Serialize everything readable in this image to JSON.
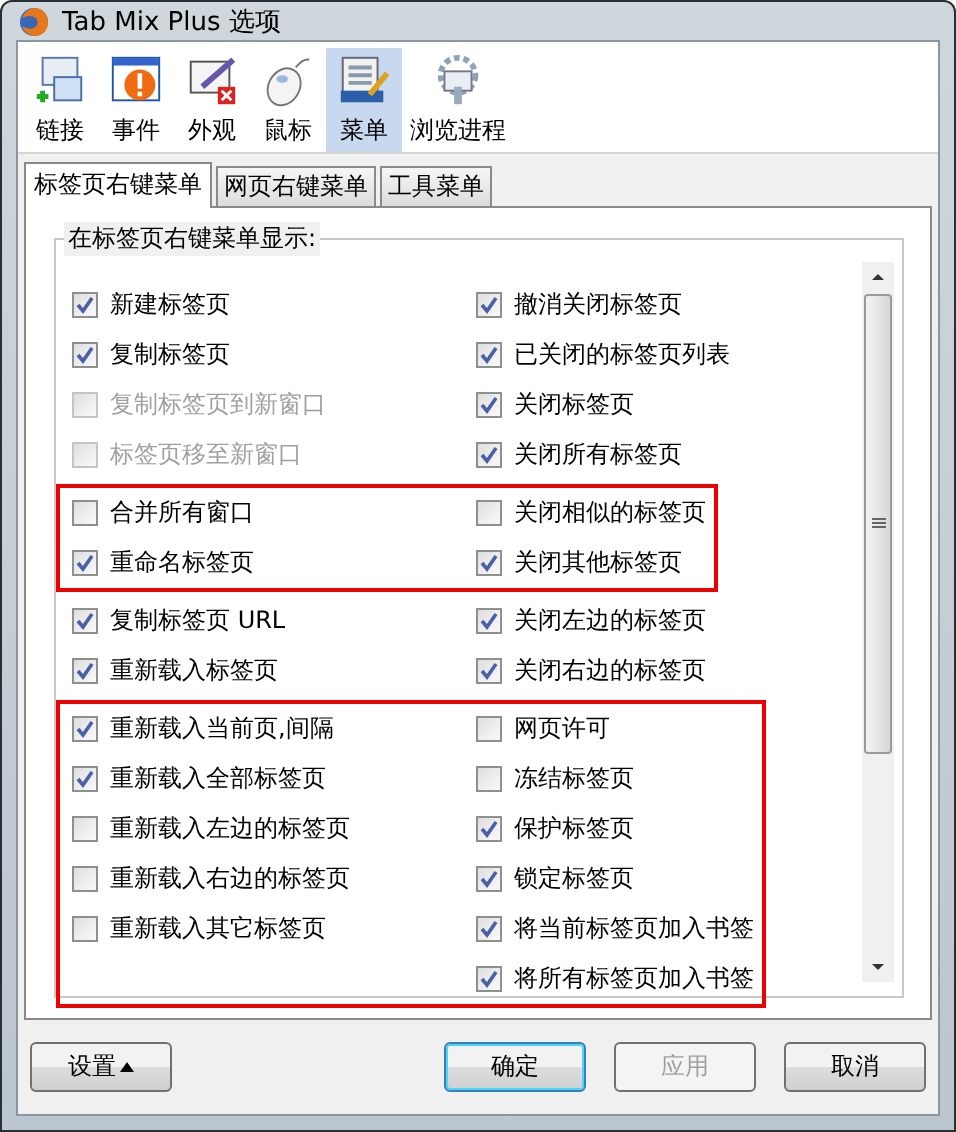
{
  "window": {
    "title": "Tab Mix Plus 选项"
  },
  "toolbar": [
    {
      "label": "链接",
      "kind": "links",
      "selected": false
    },
    {
      "label": "事件",
      "kind": "events",
      "selected": false
    },
    {
      "label": "外观",
      "kind": "display",
      "selected": false
    },
    {
      "label": "鼠标",
      "kind": "mouse",
      "selected": false
    },
    {
      "label": "菜单",
      "kind": "menu",
      "selected": true
    },
    {
      "label": "浏览进程",
      "kind": "session",
      "selected": false
    }
  ],
  "tabs": [
    {
      "label": "标签页右键菜单",
      "selected": true
    },
    {
      "label": "网页右键菜单",
      "selected": false
    },
    {
      "label": "工具菜单",
      "selected": false
    }
  ],
  "group": {
    "title": "在标签页右键菜单显示:",
    "sections": [
      {
        "highlighted": false,
        "rows": [
          {
            "left": {
              "label": "新建标签页",
              "checked": true,
              "disabled": false
            },
            "right": {
              "label": "撤消关闭标签页",
              "checked": true,
              "disabled": false
            }
          },
          {
            "left": {
              "label": "复制标签页",
              "checked": true,
              "disabled": false
            },
            "right": {
              "label": "已关闭的标签页列表",
              "checked": true,
              "disabled": false
            }
          },
          {
            "left": {
              "label": "复制标签页到新窗口",
              "checked": false,
              "disabled": true
            },
            "right": {
              "label": "关闭标签页",
              "checked": true,
              "disabled": false
            }
          },
          {
            "left": {
              "label": "标签页移至新窗口",
              "checked": false,
              "disabled": true
            },
            "right": {
              "label": "关闭所有标签页",
              "checked": true,
              "disabled": false
            }
          }
        ]
      },
      {
        "highlighted": true,
        "rows": [
          {
            "left": {
              "label": "合并所有窗口",
              "checked": false,
              "disabled": false
            },
            "right": {
              "label": "关闭相似的标签页",
              "checked": false,
              "disabled": false
            }
          },
          {
            "left": {
              "label": "重命名标签页",
              "checked": true,
              "disabled": false
            },
            "right": {
              "label": "关闭其他标签页",
              "checked": true,
              "disabled": false
            }
          }
        ]
      },
      {
        "highlighted": false,
        "rows": [
          {
            "left": {
              "label": "复制标签页 URL",
              "checked": true,
              "disabled": false
            },
            "right": {
              "label": "关闭左边的标签页",
              "checked": true,
              "disabled": false
            }
          },
          {
            "left": {
              "label": "重新载入标签页",
              "checked": true,
              "disabled": false
            },
            "right": {
              "label": "关闭右边的标签页",
              "checked": true,
              "disabled": false
            }
          }
        ]
      },
      {
        "highlighted": true,
        "rows": [
          {
            "left": {
              "label": "重新载入当前页,间隔",
              "checked": true,
              "disabled": false
            },
            "right": {
              "label": "网页许可",
              "checked": false,
              "disabled": false
            }
          },
          {
            "left": {
              "label": "重新载入全部标签页",
              "checked": true,
              "disabled": false
            },
            "right": {
              "label": "冻结标签页",
              "checked": false,
              "disabled": false
            }
          },
          {
            "left": {
              "label": "重新载入左边的标签页",
              "checked": false,
              "disabled": false
            },
            "right": {
              "label": "保护标签页",
              "checked": true,
              "disabled": false
            }
          },
          {
            "left": {
              "label": "重新载入右边的标签页",
              "checked": false,
              "disabled": false
            },
            "right": {
              "label": "锁定标签页",
              "checked": true,
              "disabled": false
            }
          },
          {
            "left": {
              "label": "重新载入其它标签页",
              "checked": false,
              "disabled": false
            },
            "right": {
              "label": "将当前标签页加入书签",
              "checked": true,
              "disabled": false
            }
          },
          {
            "right": {
              "label": "将所有标签页加入书签",
              "checked": true,
              "disabled": false
            }
          }
        ]
      }
    ]
  },
  "buttons": [
    {
      "label": "设置",
      "kind": "menu",
      "disabled": false,
      "default": false
    },
    {
      "label": "确定",
      "kind": "plain",
      "disabled": false,
      "default": true
    },
    {
      "label": "应用",
      "kind": "plain",
      "disabled": true,
      "default": false
    },
    {
      "label": "取消",
      "kind": "plain",
      "disabled": false,
      "default": false
    }
  ]
}
